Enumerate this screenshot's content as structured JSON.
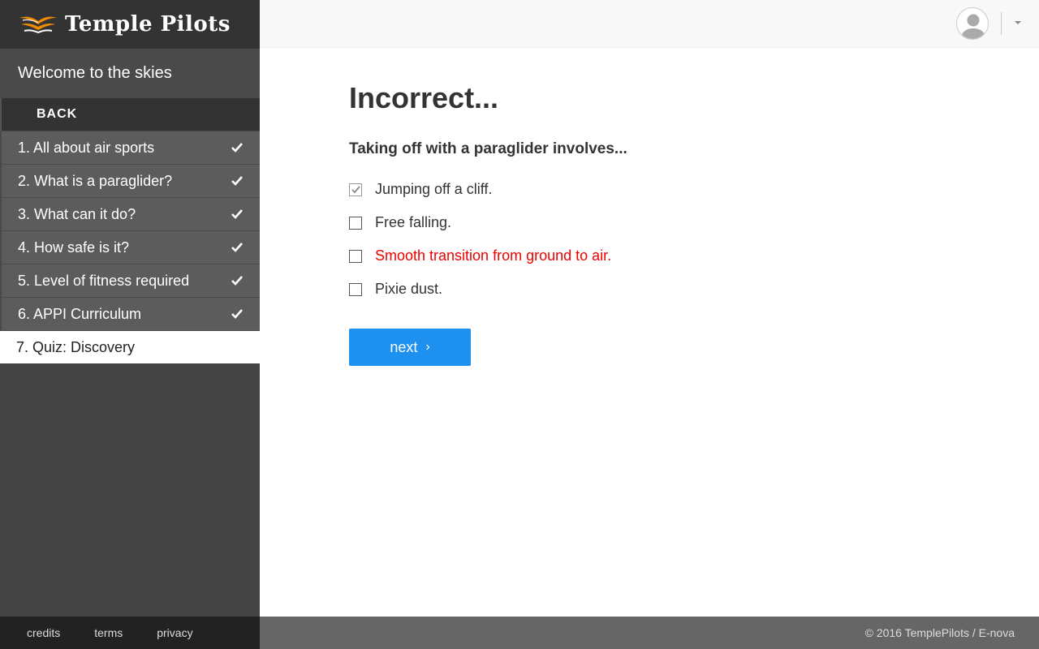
{
  "brand": {
    "name": "Temple Pilots",
    "icon": "wings-logo-icon",
    "accent": "#f08a00"
  },
  "sidebar": {
    "welcome": "Welcome to the skies",
    "back_label": "BACK",
    "items": [
      {
        "label": "1. All about air sports",
        "done": true
      },
      {
        "label": "2. What is a paraglider?",
        "done": true
      },
      {
        "label": "3. What can it do?",
        "done": true
      },
      {
        "label": "4. How safe is it?",
        "done": true
      },
      {
        "label": "5. Level of fitness required",
        "done": true
      },
      {
        "label": "6. APPI Curriculum",
        "done": true
      },
      {
        "label": "7. Quiz: Discovery",
        "done": false
      }
    ]
  },
  "footer": {
    "links": [
      "credits",
      "terms",
      "privacy"
    ],
    "copyright": "© 2016 TemplePilots / E-nova"
  },
  "quiz": {
    "result": "Incorrect...",
    "question": "Taking off with a paraglider involves...",
    "options": [
      {
        "label": "Jumping off a cliff.",
        "checked": true,
        "highlight": false
      },
      {
        "label": "Free falling.",
        "checked": false,
        "highlight": false
      },
      {
        "label": "Smooth transition from ground to air.",
        "checked": false,
        "highlight": true
      },
      {
        "label": "Pixie dust.",
        "checked": false,
        "highlight": false
      }
    ],
    "next_label": "next",
    "correct_color": "#e00000",
    "button_color": "#1e90f0"
  }
}
